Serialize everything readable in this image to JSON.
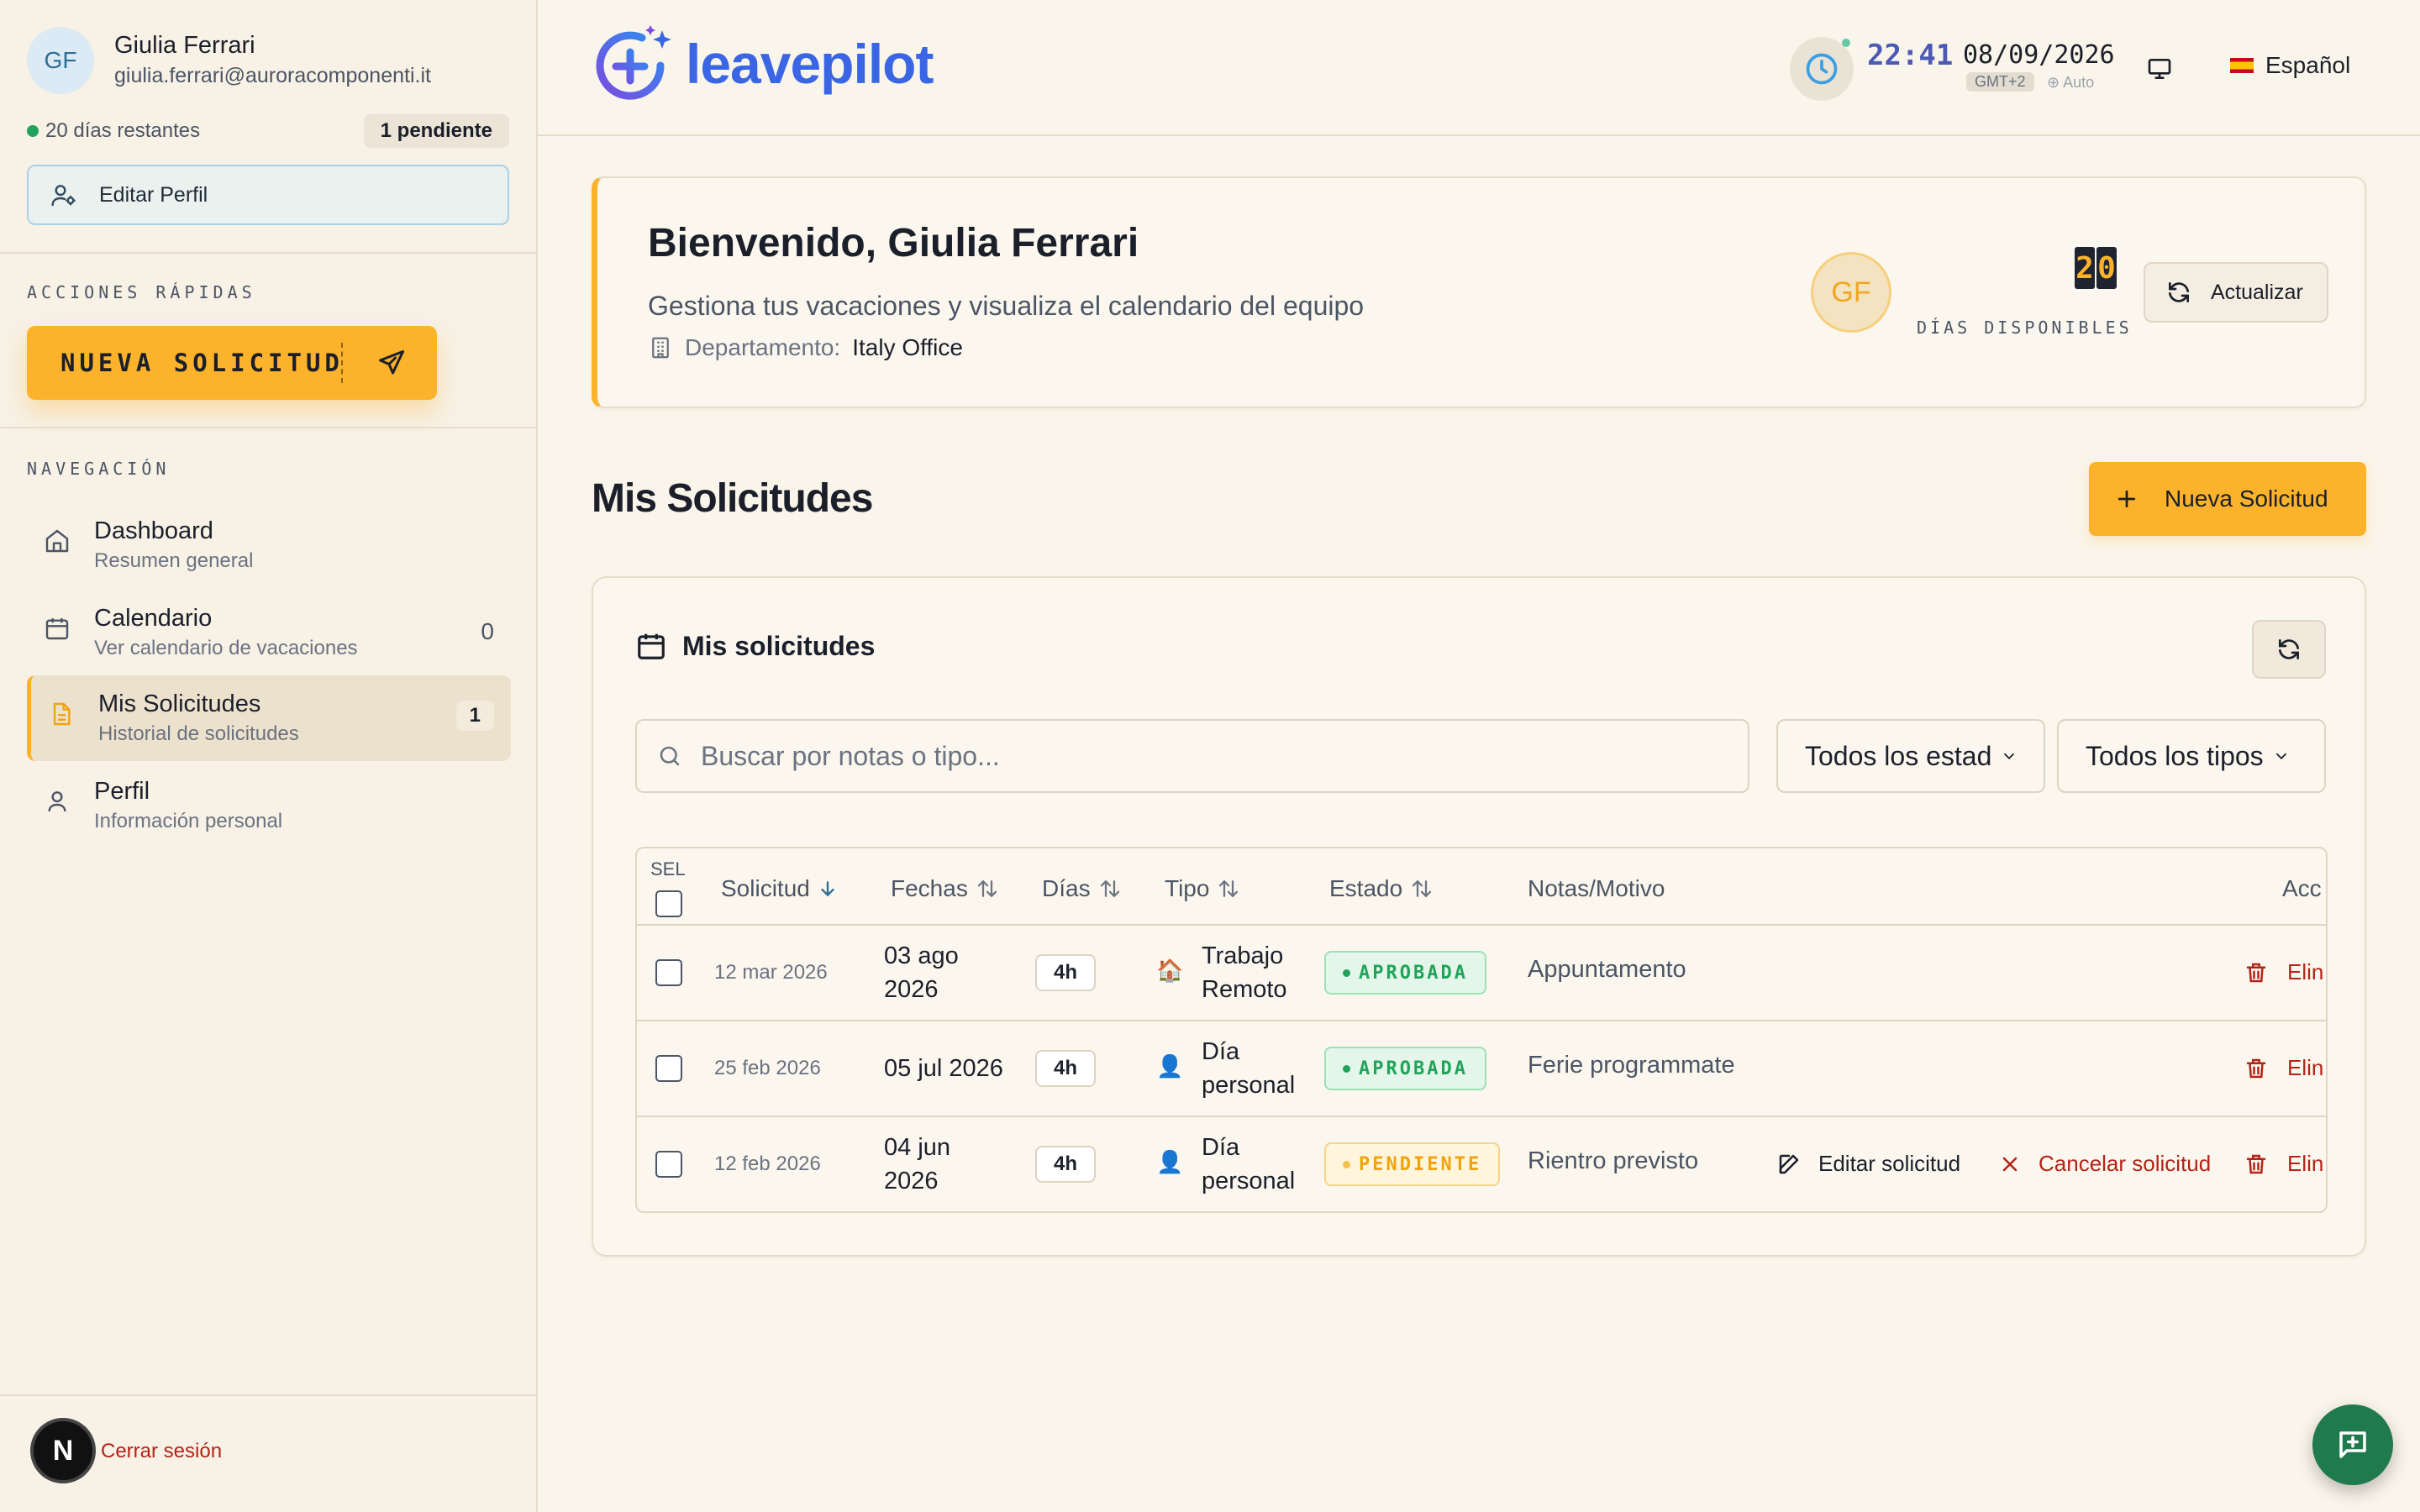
{
  "user": {
    "initials": "GF",
    "name": "Giulia Ferrari",
    "email": "giulia.ferrari@auroracomponenti.it",
    "days_remaining": "20 días restantes",
    "pending": "1 pendiente",
    "edit_profile": "Editar Perfil"
  },
  "quick_actions": {
    "label": "ACCIONES RÁPIDAS",
    "new_request": "NUEVA SOLICITUD"
  },
  "navigation": {
    "label": "NAVEGACIÓN",
    "items": [
      {
        "title": "Dashboard",
        "subtitle": "Resumen general",
        "count": ""
      },
      {
        "title": "Calendario",
        "subtitle": "Ver calendario de vacaciones",
        "count": "0"
      },
      {
        "title": "Mis Solicitudes",
        "subtitle": "Historial de solicitudes",
        "count": "1"
      },
      {
        "title": "Perfil",
        "subtitle": "Información personal",
        "count": ""
      }
    ]
  },
  "logout": {
    "label": "Cerrar sesión",
    "logo_letter": "N"
  },
  "header": {
    "logo_text": "leavepilot",
    "time": "22:41",
    "date": "08/09/2026",
    "timezone": "GMT+2",
    "tz_mode": "Auto",
    "language": "Español"
  },
  "welcome": {
    "title": "Bienvenido, Giulia Ferrari",
    "subtitle": "Gestiona tus vacaciones y visualiza el calendario del equipo",
    "department_label": "Departamento:",
    "department": "Italy Office",
    "initials": "GF",
    "days_available": "20",
    "days_digit_1": "2",
    "days_digit_2": "0",
    "days_label": "DÍAS DISPONIBLES",
    "refresh": "Actualizar"
  },
  "section": {
    "title": "Mis Solicitudes",
    "new_button": "Nueva Solicitud"
  },
  "requests": {
    "card_title": "Mis solicitudes",
    "search_placeholder": "Buscar por notas o tipo...",
    "status_filter": "Todos los estad",
    "type_filter": "Todos los tipos",
    "columns": {
      "sel": "SEL",
      "solicitud": "Solicitud",
      "fechas": "Fechas",
      "dias": "Días",
      "tipo": "Tipo",
      "estado": "Estado",
      "notas": "Notas/Motivo",
      "acciones": "Acc"
    },
    "rows": [
      {
        "created": "12 mar 2026",
        "date_l1": "03 ago",
        "date_l2": "2026",
        "days": "4h",
        "type_icon": "🏠",
        "type_l1": "Trabajo",
        "type_l2": "Remoto",
        "status": "APROBADA",
        "notes": "Appuntamento",
        "delete": "Elin"
      },
      {
        "created": "25 feb 2026",
        "date_l1": "05 jul 2026",
        "date_l2": "",
        "days": "4h",
        "type_icon": "👤",
        "type_l1": "Día",
        "type_l2": "personal",
        "status": "APROBADA",
        "notes": "Ferie programmate",
        "delete": "Elin"
      },
      {
        "created": "12 feb 2026",
        "date_l1": "04 jun",
        "date_l2": "2026",
        "days": "4h",
        "type_icon": "👤",
        "type_l1": "Día",
        "type_l2": "personal",
        "status": "PENDIENTE",
        "notes": "Rientro previsto",
        "edit": "Editar solicitud",
        "cancel": "Cancelar solicitud",
        "delete": "Elin"
      }
    ]
  },
  "colors": {
    "accent": "#fcb32b",
    "approved": "#22a35b",
    "pending": "#f0a30a",
    "danger": "#b42318",
    "brand": "#3a66e6"
  }
}
